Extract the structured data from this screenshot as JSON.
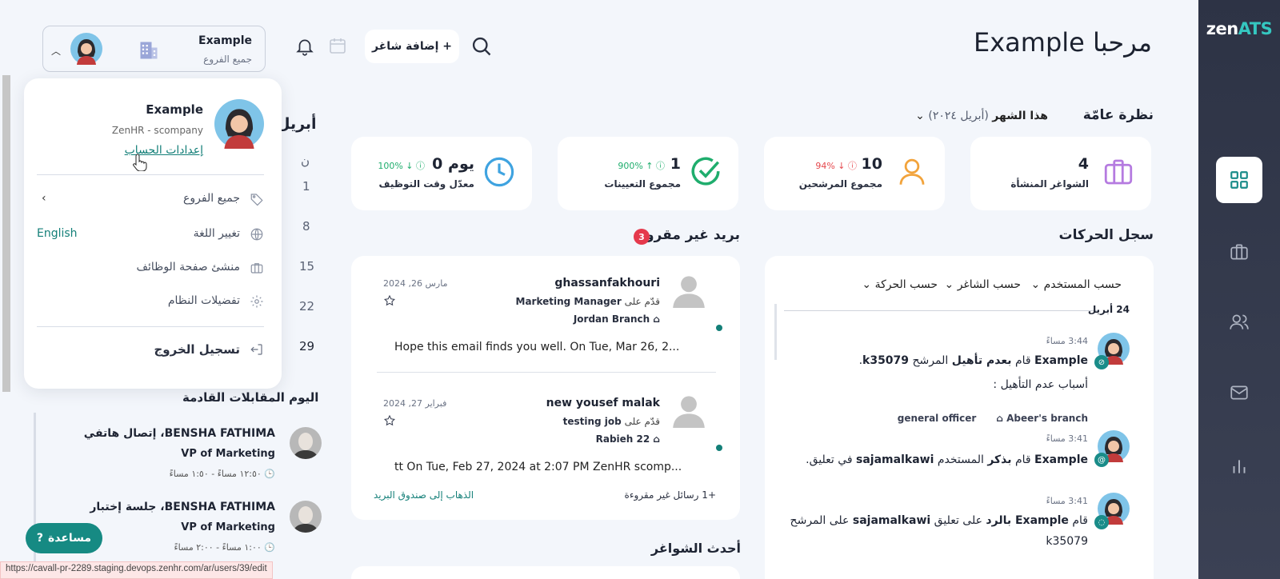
{
  "app": {
    "logo_main": "zen",
    "logo_accent": "ATS"
  },
  "header": {
    "welcome": "مرحبا Example",
    "add_job": "+ إضافة شاغر",
    "user_name": "Example",
    "user_branch": "جميع الفروع"
  },
  "overview": {
    "title": "نظرة عامّة",
    "period_label": "هذا الشهر",
    "period_value": "(أبريل ٢٠٢٤)"
  },
  "stats": [
    {
      "value": "4",
      "pct": "",
      "label": "الشواغر المنشأة",
      "color": "#b57be0"
    },
    {
      "value": "10",
      "pct": "94% ↓",
      "label": "مجموع المرشحين",
      "color": "#f2a33b"
    },
    {
      "value": "1",
      "pct": "900% ↑",
      "label": "مجموع التعيينات",
      "color": "#1fad6d"
    },
    {
      "value": "0 يوم",
      "pct": "100% ↓",
      "label": "معدّل وقت التوظيف",
      "color": "#3fa3e0"
    }
  ],
  "activity": {
    "title": "سجل الحركات",
    "filters": [
      "حسب المستخدم",
      "حسب الشاغر",
      "حسب الحركة"
    ],
    "date": "24 أبريل",
    "items": [
      {
        "time": "3:44 مساءً",
        "line1_actor": "Example",
        "line1_rest": " قام ",
        "line1_action": "بعدم تأهيل",
        "line1_rest2": " المرشح ",
        "line1_target": "k35079",
        "line2": "أسباب عدم التأهيل :",
        "tag1": "general officer",
        "tag2": "Abeer's branch"
      },
      {
        "time": "3:41 مساءً",
        "actor": "Example",
        "t1": " قام ",
        "action": "بذكر",
        "t2": " المستخدم ",
        "target": "sajamalkawi",
        "t3": " في تعليق."
      },
      {
        "time": "3:41 مساءً",
        "t0": "قام ",
        "actor": "Example",
        "action": " بالرد",
        "t1": " على تعليق ",
        "target": "sajamalkawi",
        "t2": " على المرشح",
        "line2": "k35079"
      }
    ]
  },
  "mail": {
    "title": "بريد غير مقروء",
    "count": "3",
    "items": [
      {
        "from": "ghassanfakhouri",
        "applied": "قدّم على",
        "position": "Marketing Manager",
        "branch": "Jordan Branch",
        "date": "مارس 26, 2024",
        "snippet": "Hope this email finds you well. On Tue, Mar 26, 2..."
      },
      {
        "from": "new yousef malak",
        "applied": "قدّم على",
        "position": "testing job",
        "branch": "Rabieh 22",
        "date": "فبراير 27, 2024",
        "snippet": "tt On Tue, Feb 27, 2024 at 2:07 PM ZenHR scomp..."
      }
    ],
    "more": "+1 رسائل غير مقروءة",
    "go_inbox": "الذهاب إلى صندوق البريد"
  },
  "calendar": {
    "month": "أبريل",
    "day_header": "ن",
    "days": [
      "1",
      "8",
      "15",
      "22",
      "29"
    ]
  },
  "interviews": {
    "title": "اليوم المقابلات القادمة",
    "items": [
      {
        "name": "BENSHA FATHIMA، إتصال هاتفي",
        "role": "VP of Marketing",
        "time": "١٢:٥٠ مساءً - ١:٥٠ مساءً"
      },
      {
        "name": "BENSHA FATHIMA، جلسة إختبار",
        "role": "VP of Marketing",
        "time": "١:٠٠ مساءً - ٢:٠٠ مساءً"
      }
    ]
  },
  "dropdown": {
    "name": "Example",
    "company": "ZenHR - scompany",
    "account_settings": "إعدادات الحساب",
    "rows": [
      {
        "label": "جميع الفروع",
        "aside": ""
      },
      {
        "label": "تغيير اللغة",
        "aside": "English"
      },
      {
        "label": "منشئ صفحة الوظائف",
        "aside": ""
      },
      {
        "label": "تفضيلات النظام",
        "aside": ""
      }
    ],
    "logout": "تسجيل الخروج"
  },
  "latest_jobs": {
    "title": "أحدث الشواغر"
  },
  "help": {
    "label": "مساعدة"
  },
  "status_bar": {
    "url": "https://cavall-pr-2289.staging.devops.zenhr.com/ar/users/39/edit"
  }
}
